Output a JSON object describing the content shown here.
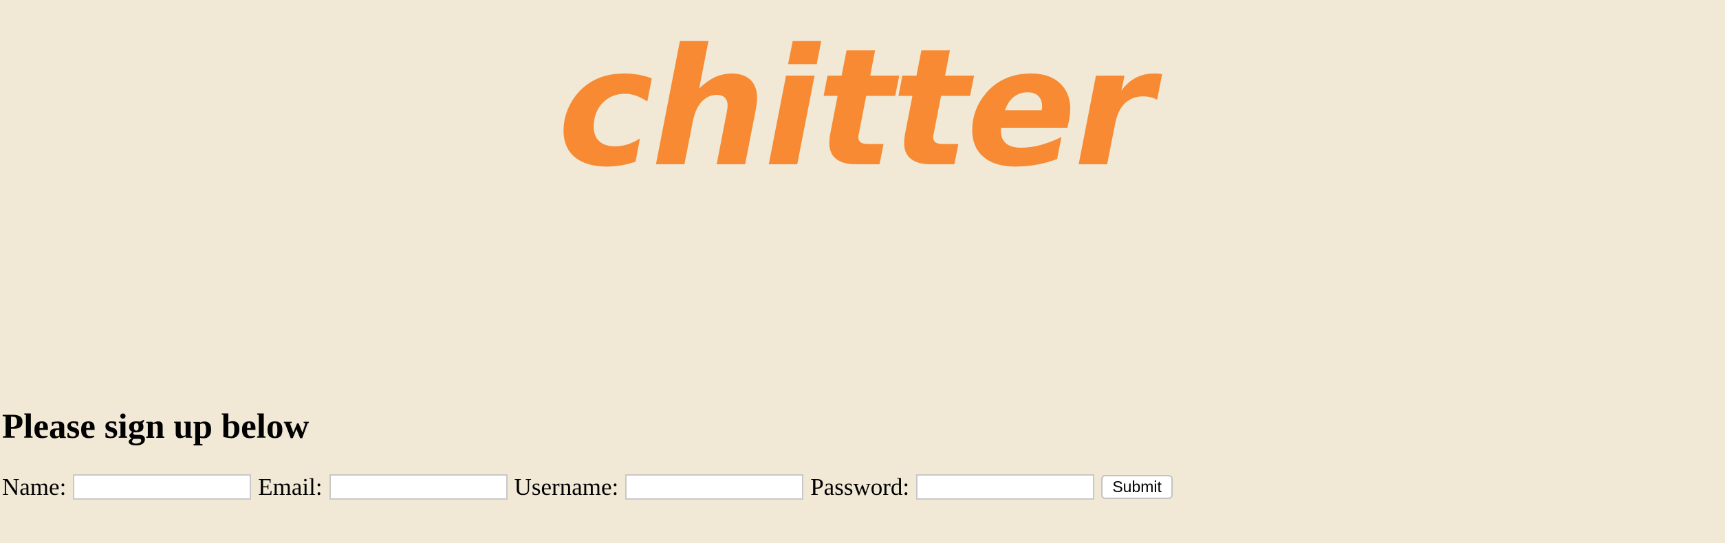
{
  "logo": {
    "text": "chitter",
    "color": "#f78a32"
  },
  "page": {
    "heading": "Please sign up below",
    "background": "#f1e9d6"
  },
  "signup_form": {
    "name_label": "Name:",
    "name_value": "",
    "email_label": "Email:",
    "email_value": "",
    "username_label": "Username:",
    "username_value": "",
    "password_label": "Password:",
    "password_value": "",
    "submit_label": "Submit"
  }
}
